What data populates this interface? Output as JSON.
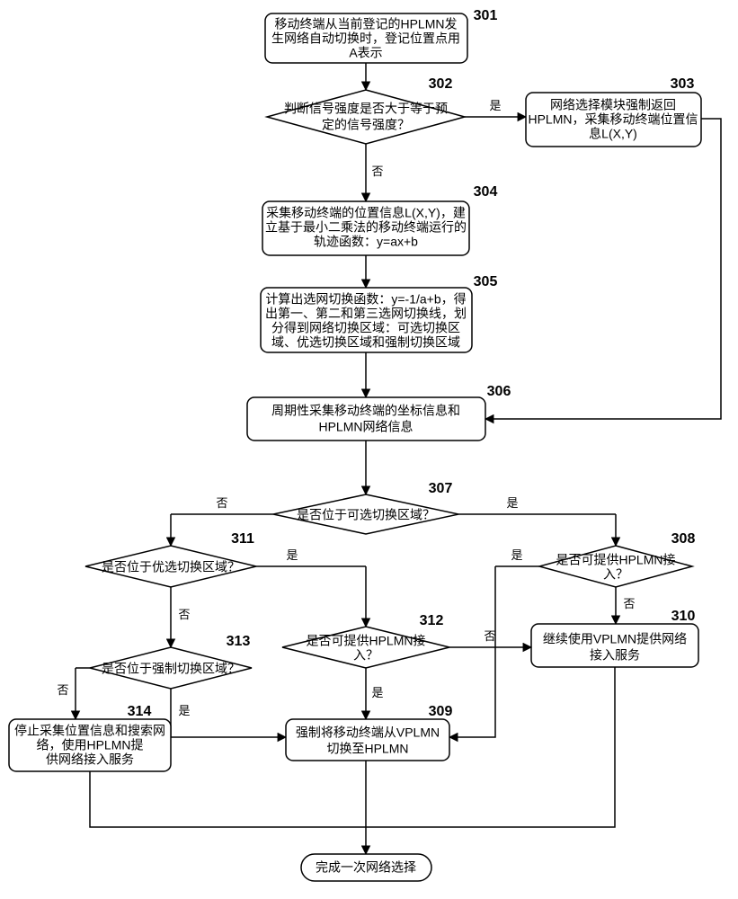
{
  "n301": {
    "num": "301",
    "l1": "移动终端从当前登记的HPLMN发",
    "l2": "生网络自动切换时，登记位置点用",
    "l3": "A表示"
  },
  "n302": {
    "num": "302",
    "l1": "判断信号强度是否大于等于预",
    "l2": "定的信号强度？"
  },
  "n303": {
    "num": "303",
    "l1": "网络选择模块强制返回",
    "l2": "HPLMN，采集移动终端位置信",
    "l3": "息L(X,Y)"
  },
  "n304": {
    "num": "304",
    "l1": "采集移动终端的位置信息L(X,Y)，建",
    "l2": "立基于最小二乘法的移动终端运行的",
    "l3": "轨迹函数：y=ax+b"
  },
  "n305": {
    "num": "305",
    "l1": "计算出选网切换函数：y=-1/a+b，得",
    "l2": "出第一、第二和第三选网切换线，划",
    "l3": "分得到网络切换区域：可选切换区",
    "l4": "域、优选切换区域和强制切换区域"
  },
  "n306": {
    "num": "306",
    "l1": "周期性采集移动终端的坐标信息和",
    "l2": "HPLMN网络信息"
  },
  "n307": {
    "num": "307",
    "l1": "是否位于可选切换区域？"
  },
  "n308": {
    "num": "308",
    "l1": "是否可提供HPLMN接",
    "l2": "入？"
  },
  "n309": {
    "num": "309",
    "l1": "强制将移动终端从VPLMN",
    "l2": "切换至HPLMN"
  },
  "n310": {
    "num": "310",
    "l1": "继续使用VPLMN提供网络",
    "l2": "接入服务"
  },
  "n311": {
    "num": "311",
    "l1": "是否位于优选切换区域？"
  },
  "n312": {
    "num": "312",
    "l1": "是否可提供HPLMN接",
    "l2": "入？"
  },
  "n313": {
    "num": "313",
    "l1": "是否位于强制切换区域？"
  },
  "n314": {
    "num": "314",
    "l1": "停止采集位置信息和搜索网",
    "l2": "络，使用HPLMN提",
    "l3": "供网络接入服务"
  },
  "end": {
    "l1": "完成一次网络选择"
  },
  "yes": "是",
  "no": "否"
}
